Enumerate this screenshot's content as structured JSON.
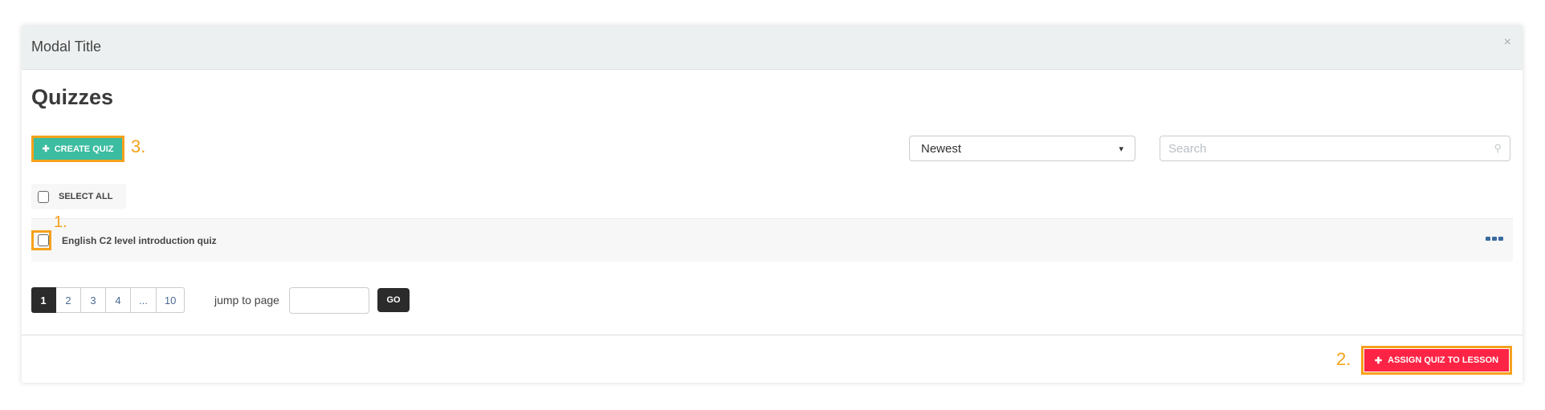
{
  "modal": {
    "title": "Modal Title",
    "close": "×"
  },
  "heading": "Quizzes",
  "toolbar": {
    "create_label": "CREATE QUIZ",
    "sort_value": "Newest",
    "search_placeholder": "Search"
  },
  "list": {
    "select_all": "SELECT ALL",
    "items": [
      {
        "name": "English C2 level introduction quiz"
      }
    ]
  },
  "pagination": {
    "pages": [
      "1",
      "2",
      "3",
      "4",
      "...",
      "10"
    ],
    "current": "1",
    "jump_label": "jump to page",
    "go_label": "GO"
  },
  "footer": {
    "assign_label": "ASSIGN QUIZ TO LESSON"
  },
  "annotations": [
    "1.",
    "2.",
    "3."
  ],
  "colors": {
    "create": "#3cbca0",
    "assign": "#fe2446",
    "highlight": "#f5a11d",
    "dark": "#2b2b2b"
  }
}
